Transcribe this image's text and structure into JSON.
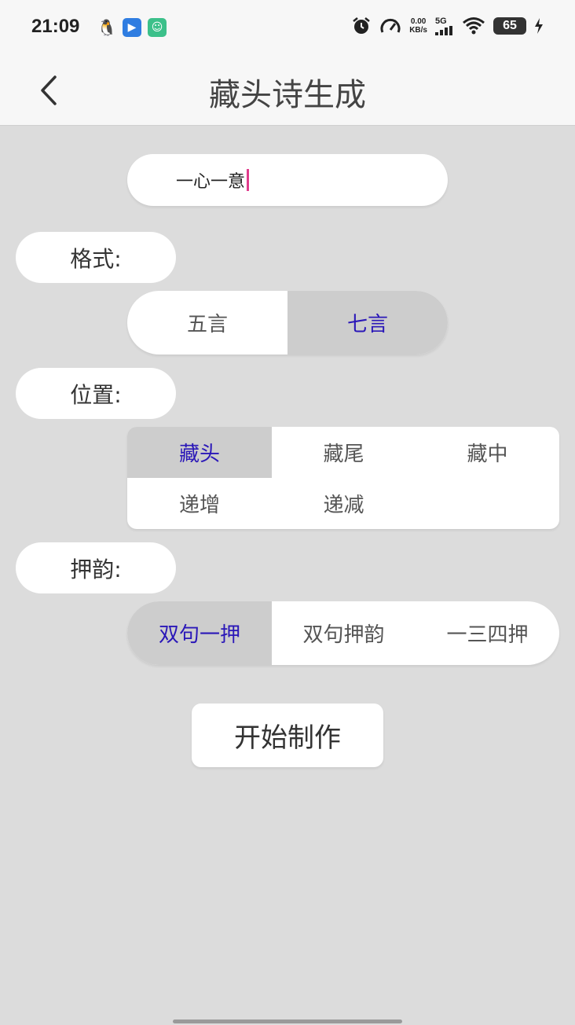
{
  "status_bar": {
    "time": "21:09",
    "net_speed_value": "0.00",
    "net_speed_unit": "KB/s",
    "signal_label": "5G",
    "battery": "65"
  },
  "header": {
    "title": "藏头诗生成"
  },
  "input": {
    "value": "一心一意"
  },
  "format": {
    "label": "格式:",
    "options": [
      "五言",
      "七言"
    ],
    "selected": "七言"
  },
  "position": {
    "label": "位置:",
    "options": [
      "藏头",
      "藏尾",
      "藏中",
      "递增",
      "递减"
    ],
    "selected": "藏头"
  },
  "rhyme": {
    "label": "押韵:",
    "options": [
      "双句一押",
      "双句押韵",
      "一三四押"
    ],
    "selected": "双句一押"
  },
  "actions": {
    "start_label": "开始制作"
  },
  "colors": {
    "selected_text": "#2a17b8",
    "selected_bg": "#cdcdcd",
    "background": "#dcdcdc",
    "caret": "#e03c8c"
  }
}
